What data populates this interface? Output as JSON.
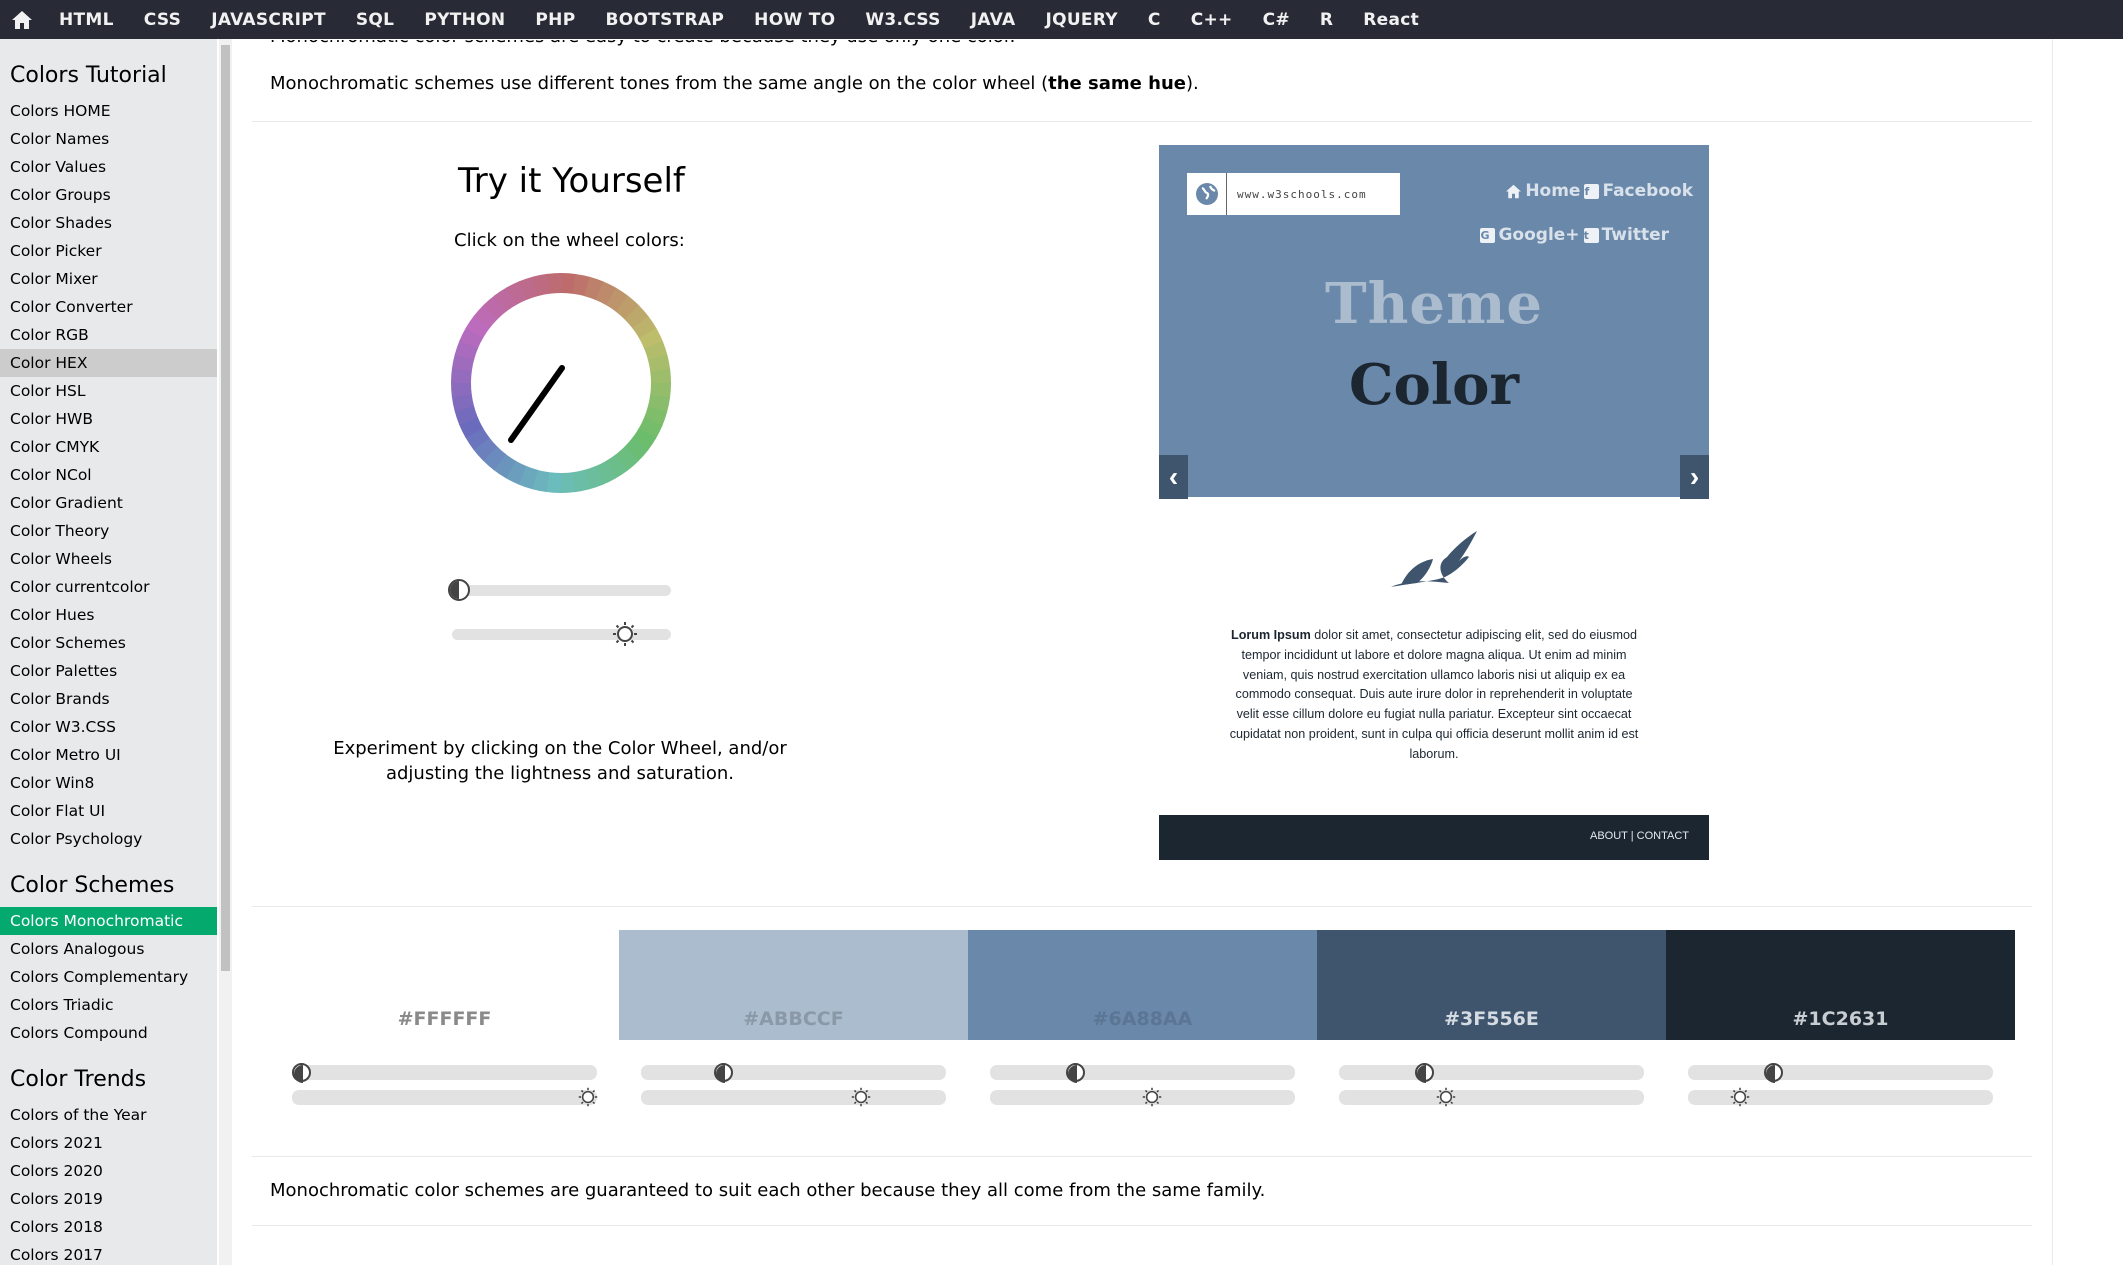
{
  "topnav": {
    "links": [
      "HTML",
      "CSS",
      "JAVASCRIPT",
      "SQL",
      "PYTHON",
      "PHP",
      "BOOTSTRAP",
      "HOW TO",
      "W3.CSS",
      "JAVA",
      "JQUERY",
      "C",
      "C++",
      "C#",
      "R",
      "React"
    ]
  },
  "sidebar": {
    "heading1": "Colors Tutorial",
    "items1": [
      "Colors HOME",
      "Color Names",
      "Color Values",
      "Color Groups",
      "Color Shades",
      "Color Picker",
      "Color Mixer",
      "Color Converter",
      "Color RGB",
      "Color HEX",
      "Color HSL",
      "Color HWB",
      "Color CMYK",
      "Color NCol",
      "Color Gradient",
      "Color Theory",
      "Color Wheels",
      "Color currentcolor",
      "Color Hues",
      "Color Schemes",
      "Color Palettes",
      "Color Brands",
      "Color W3.CSS",
      "Color Metro UI",
      "Color Win8",
      "Color Flat UI",
      "Color Psychology"
    ],
    "heading2": "Color Schemes",
    "items2": [
      "Colors Monochromatic",
      "Colors Analogous",
      "Colors Complementary",
      "Colors Triadic",
      "Colors Compound"
    ],
    "heading3": "Color Trends",
    "items3": [
      "Colors of the Year",
      "Colors 2021",
      "Colors 2020",
      "Colors 2019",
      "Colors 2018",
      "Colors 2017"
    ],
    "highlighted": "Color HEX",
    "active": "Colors Monochromatic"
  },
  "main": {
    "intro_clipped": "Monochromatic color schemes are easy to create because they use only one color.",
    "intro_pre": "Monochromatic schemes use different tones from the same angle on the color wheel (",
    "intro_bold": "the same hue",
    "intro_post": ").",
    "try_title": "Try it Yourself",
    "try_sub": "Click on the wheel colors:",
    "experiment": "Experiment by clicking on the Color Wheel, and/or adjusting the lightness and saturation.",
    "bottom_text": "Monochromatic color schemes are guaranteed to suit each other because they all come from the same family."
  },
  "sliders": {
    "main_lightness": 0.03,
    "main_saturation": 0.79
  },
  "preview": {
    "url": "www.w3schools.com",
    "nav_home": "Home",
    "nav_facebook": "Facebook",
    "nav_google": "Google+",
    "nav_twitter": "Twitter",
    "theme_word": "Theme",
    "color_word": "Color",
    "lorem_bold": "Lorum Ipsum",
    "lorem_text": " dolor sit amet, consectetur adipiscing elit, sed do eiusmod tempor incididunt ut labore et dolore magna aliqua. Ut enim ad minim veniam, quis nostrud exercitation ullamco laboris nisi ut aliquip ex ea commodo consequat. Duis aute irure dolor in reprehenderit in voluptate velit esse cillum dolore eu fugiat nulla pariatur. Excepteur sint occaecat cupidatat non proident, sunt in culpa qui officia deserunt mollit anim id est laborum.",
    "footer_links": "ABOUT | CONTACT"
  },
  "swatches": [
    {
      "hex": "#FFFFFF",
      "bg": "#ffffff",
      "fg": "#8a8a8a",
      "lightness": 0.03,
      "saturation": 0.97
    },
    {
      "hex": "#ABBCCF",
      "bg": "#abbccf",
      "fg": "#8a98a8",
      "lightness": 0.27,
      "saturation": 0.72
    },
    {
      "hex": "#6A88AA",
      "bg": "#6a88aa",
      "fg": "#5b7594",
      "lightness": 0.28,
      "saturation": 0.53
    },
    {
      "hex": "#3F556E",
      "bg": "#3f556e",
      "fg": "#d5dbe2",
      "lightness": 0.28,
      "saturation": 0.35
    },
    {
      "hex": "#1C2631",
      "bg": "#1c2631",
      "fg": "#c8cdd2",
      "lightness": 0.28,
      "saturation": 0.17
    }
  ],
  "colors": {
    "nav_bg": "#282a35",
    "sidebar_bg": "#e7e9eb",
    "active_green": "#04aa6d"
  }
}
